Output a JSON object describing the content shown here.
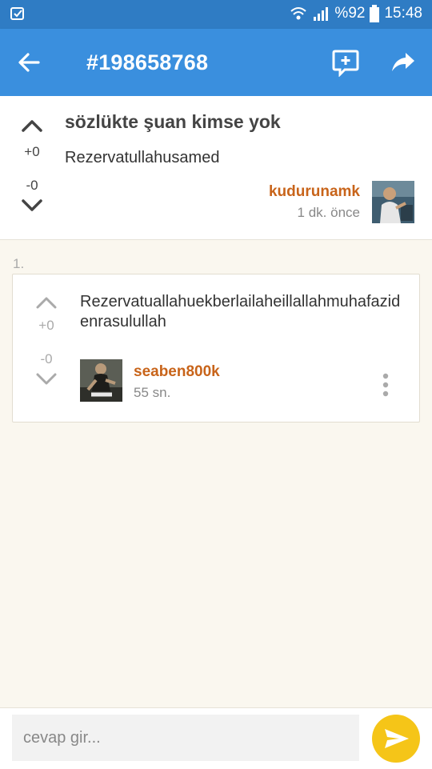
{
  "status_bar": {
    "battery_text": "%92",
    "clock": "15:48",
    "icons": [
      "notification-icon",
      "wifi-icon",
      "signal-icon",
      "battery-icon"
    ]
  },
  "app_bar": {
    "title": "#198658768",
    "icons": [
      "back-arrow-icon",
      "new-reply-icon",
      "share-icon"
    ]
  },
  "topic": {
    "title": "sözlükte şuan kimse yok",
    "body": "Rezervatullahusamed",
    "author": "kudurunamk",
    "time": "1 dk. önce",
    "votes": {
      "plus": "+0",
      "minus": "-0"
    }
  },
  "replies": [
    {
      "index": "1.",
      "body": "Rezervatuallahuekberlailaheillallahmuhafazidenrasulullah",
      "author": "seaben800k",
      "time": "55 sn.",
      "votes": {
        "plus": "+0",
        "minus": "-0"
      }
    }
  ],
  "reply_input": {
    "placeholder": "cevap gir..."
  },
  "colors": {
    "status_bar": "#2f7cc4",
    "app_bar": "#3a8fde",
    "author": "#c8641a",
    "send_button": "#f5c518",
    "background": "#faf7ef"
  }
}
